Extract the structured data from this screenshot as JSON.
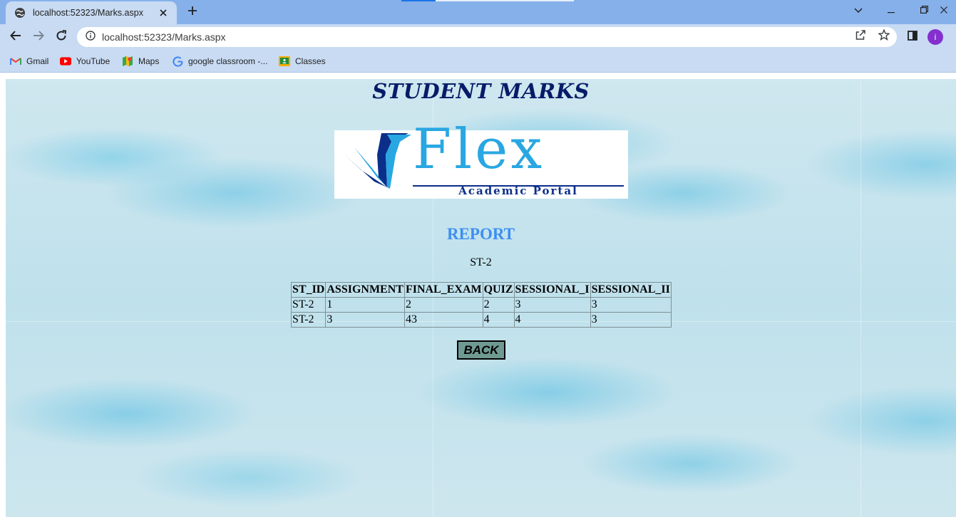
{
  "browser": {
    "tab": {
      "title": "localhost:52323/Marks.aspx"
    },
    "address_bar": {
      "url": "localhost:52323/Marks.aspx"
    },
    "profile_initial": "i",
    "bookmarks": [
      {
        "label": "Gmail",
        "icon": "gmail-icon"
      },
      {
        "label": "YouTube",
        "icon": "youtube-icon"
      },
      {
        "label": "Maps",
        "icon": "maps-icon"
      },
      {
        "label": "google classroom -...",
        "icon": "google-icon"
      },
      {
        "label": "Classes",
        "icon": "classroom-icon"
      }
    ]
  },
  "page": {
    "title": "STUDENT MARKS",
    "logo": {
      "word": "Flex",
      "tagline": "Academic Portal"
    },
    "report_heading": "REPORT",
    "student_id": "ST-2",
    "table": {
      "columns": [
        "ST_ID",
        "ASSIGNMENT",
        "FINAL_EXAM",
        "QUIZ",
        "SESSIONAL_I",
        "SESSIONAL_II"
      ],
      "rows": [
        [
          "ST-2",
          "1",
          "2",
          "2",
          "3",
          "3"
        ],
        [
          "ST-2",
          "3",
          "43",
          "4",
          "4",
          "3"
        ]
      ]
    },
    "back_button": "BACK"
  },
  "colors": {
    "title": "#061c68",
    "report_heading": "#3d8ff0",
    "back_button_bg": "#6f9a92",
    "logo_blue": "#29a7e2",
    "logo_navy": "#0b2e8a"
  }
}
